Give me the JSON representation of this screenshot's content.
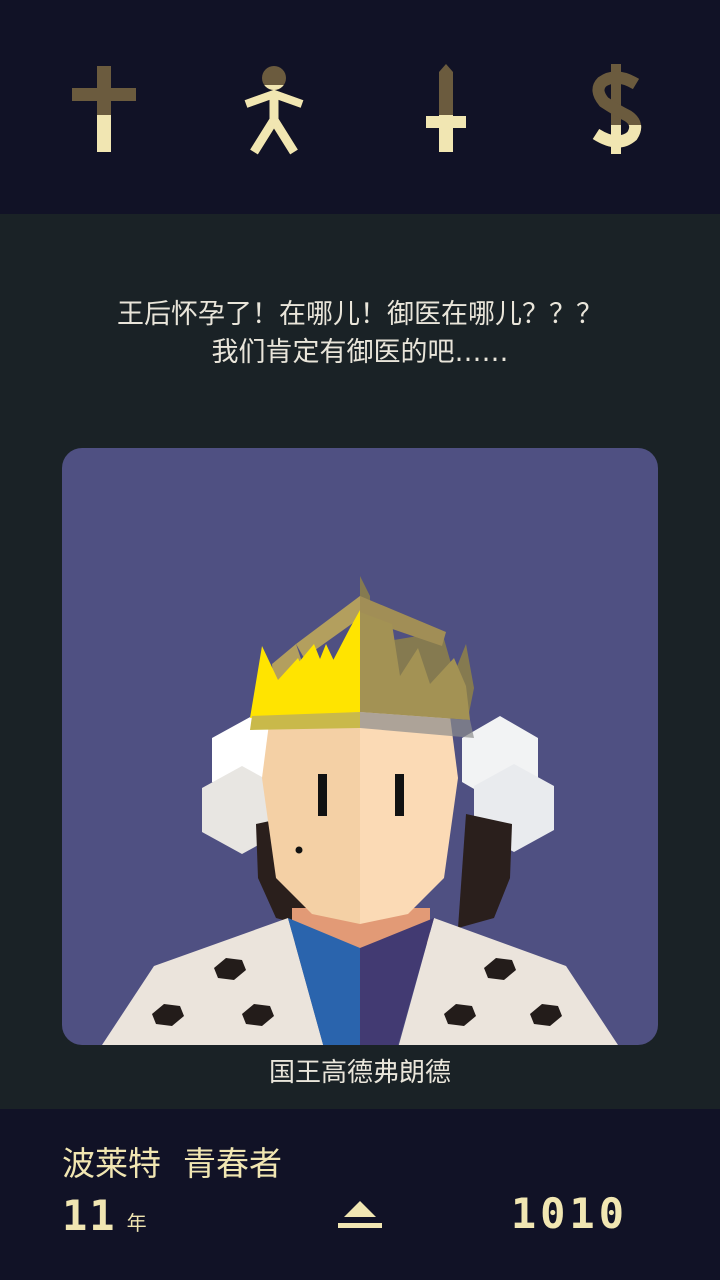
{
  "colors": {
    "top_bar_bg": "#111226",
    "main_bg": "#1a2226",
    "card_bg": "#4f5082",
    "stat_fill": "#f1e6b2",
    "stat_empty": "#6b5b3e",
    "text_light": "#e9e5da",
    "gold": "#f1e6b2"
  },
  "stats": [
    {
      "name": "church",
      "icon": "cross-icon",
      "level": 0.45
    },
    {
      "name": "people",
      "icon": "person-icon",
      "level": 0.75
    },
    {
      "name": "army",
      "icon": "sword-icon",
      "level": 0.45
    },
    {
      "name": "treasury",
      "icon": "dollar-icon",
      "level": 0.35
    }
  ],
  "card": {
    "question_line1": "王后怀孕了！在哪儿！御医在哪儿？？？",
    "question_line2": "我们肯定有御医的吧……",
    "character_name": "国王高德弗朗德",
    "portrait_icon": "king-portrait"
  },
  "ruler": {
    "name": "波莱特",
    "epithet": "青春者",
    "years": "11",
    "years_unit": "年",
    "date": "1010"
  }
}
